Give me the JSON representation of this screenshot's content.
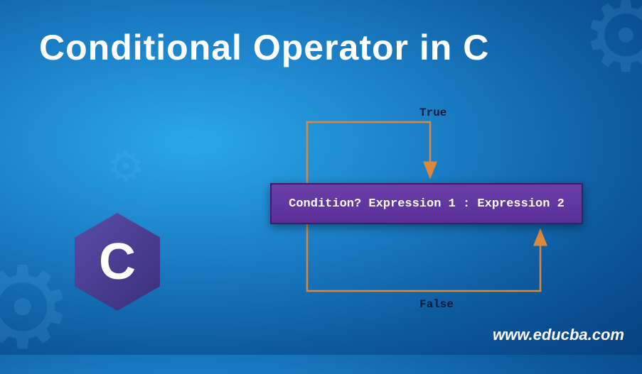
{
  "title": "Conditional Operator in C",
  "logo_letter": "C",
  "diagram": {
    "true_label": "True",
    "false_label": "False",
    "expression": {
      "condition": "Condition?",
      "expr1": "Expression 1",
      "sep": " : ",
      "expr2": "Expression 2"
    }
  },
  "website": "www.educba.com",
  "colors": {
    "arrow": "#d98840",
    "box_bg": "#5a2f98"
  }
}
